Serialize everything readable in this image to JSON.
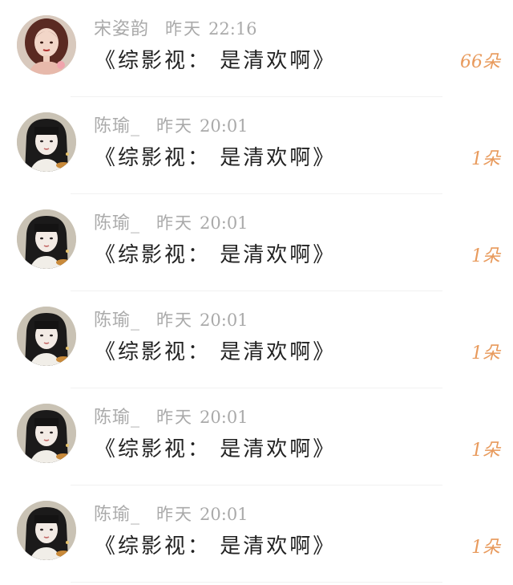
{
  "colors": {
    "accent": "#e89a5c",
    "name_text": "#aaaaaa",
    "message_text": "#222222",
    "divider": "#f1f1f1"
  },
  "comments": [
    {
      "username": "宋姿韵",
      "date": "昨天",
      "time": "22:16",
      "message": "《综影视： 是清欢啊》",
      "count": "66朵",
      "avatar_icon": "user-avatar-red-hair"
    },
    {
      "username": "陈瑜_",
      "date": "昨天",
      "time": "20:01",
      "message": "《综影视： 是清欢啊》",
      "count": "1朵",
      "avatar_icon": "user-avatar-dark-hair"
    },
    {
      "username": "陈瑜_",
      "date": "昨天",
      "time": "20:01",
      "message": "《综影视： 是清欢啊》",
      "count": "1朵",
      "avatar_icon": "user-avatar-dark-hair"
    },
    {
      "username": "陈瑜_",
      "date": "昨天",
      "time": "20:01",
      "message": "《综影视： 是清欢啊》",
      "count": "1朵",
      "avatar_icon": "user-avatar-dark-hair"
    },
    {
      "username": "陈瑜_",
      "date": "昨天",
      "time": "20:01",
      "message": "《综影视： 是清欢啊》",
      "count": "1朵",
      "avatar_icon": "user-avatar-dark-hair"
    },
    {
      "username": "陈瑜_",
      "date": "昨天",
      "time": "20:01",
      "message": "《综影视： 是清欢啊》",
      "count": "1朵",
      "avatar_icon": "user-avatar-dark-hair"
    }
  ]
}
